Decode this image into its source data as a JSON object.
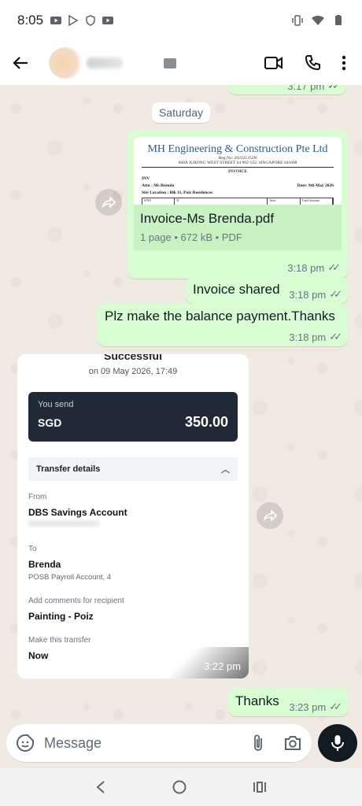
{
  "status_bar": {
    "time": "8:05"
  },
  "header": {
    "back_icon": "arrow-back-icon",
    "actions": [
      "video-call-icon",
      "voice-call-icon",
      "more-vert-icon"
    ]
  },
  "chat": {
    "date_chip": "Saturday",
    "partial_top_time": "3:17 pm",
    "document": {
      "preview": {
        "company": "MH Engineering & Construction Pte Ltd",
        "reg": "Reg.No: 202121352N",
        "address": "668A JURONG WEST STREET 64 #02-122, SINGAPORE 641668",
        "heading": "INVOICE",
        "inv": "INV",
        "attn": "Attn : Ms Brenda",
        "date": "Date: 9th May 2026",
        "site": "Site Location : Blk 11, Poiz Residences",
        "columns": [
          "S/NO",
          "D",
          "Area",
          "Total Amount"
        ]
      },
      "file_name": "Invoice-Ms Brenda.pdf",
      "file_meta": "1 page • 672 kB • PDF",
      "time": "3:18 pm"
    },
    "messages": [
      {
        "text": "Invoice shared",
        "time": "3:18 pm"
      },
      {
        "text": "Plz make the balance payment.Thanks",
        "time": "3:18 pm"
      }
    ],
    "screenshot": {
      "header": "Successful",
      "date": "on 09 May 2026, 17:49",
      "you_send_label": "You send",
      "currency": "SGD",
      "amount": "350.00",
      "transfer_details": "Transfer details",
      "from_label": "From",
      "from_value": "DBS Savings Account",
      "to_label": "To",
      "to_value": "Brenda",
      "to_sub": "POSB Payroll Account, 4",
      "comments_label": "Add comments for recipient",
      "comments_value": "Painting - Poiz",
      "when_label": "Make this transfer",
      "when_value": "Now",
      "time": "3:22 pm"
    },
    "last_message": {
      "text": "Thanks",
      "time": "3:23 pm"
    }
  },
  "composer": {
    "placeholder": "Message"
  },
  "colors": {
    "outgoing": "#d9fdd3",
    "incoming": "#ffffff",
    "wallpaper": "#efeae2",
    "mic": "#111b21"
  }
}
